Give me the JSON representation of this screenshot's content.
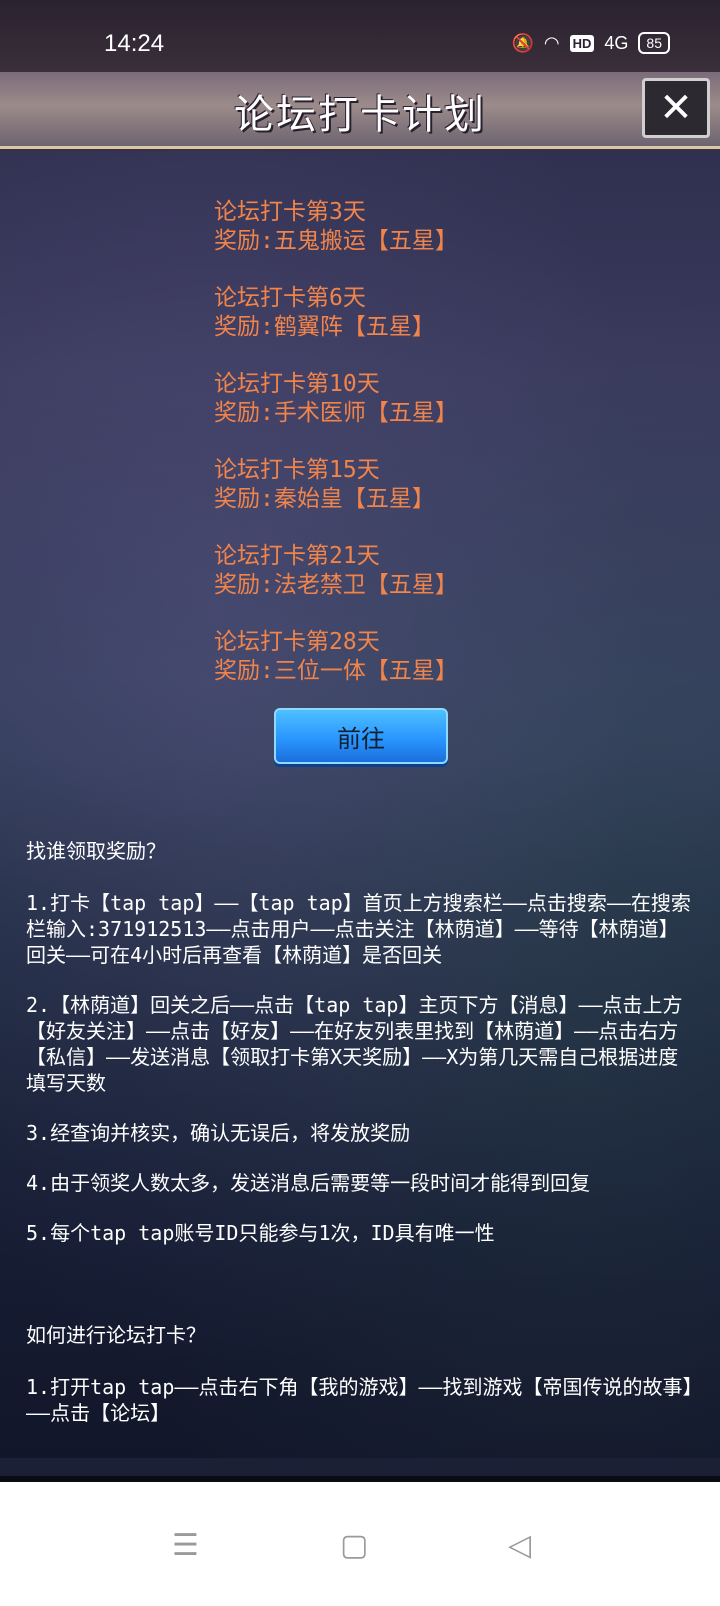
{
  "status": {
    "time": "14:24",
    "network": "4G",
    "hd": "HD",
    "battery": "85"
  },
  "header": {
    "title": "论坛打卡计划"
  },
  "rewards": [
    {
      "day": "论坛打卡第3天",
      "reward": "奖励:五鬼搬运【五星】"
    },
    {
      "day": "论坛打卡第6天",
      "reward": "奖励:鹤翼阵【五星】"
    },
    {
      "day": "论坛打卡第10天",
      "reward": "奖励:手术医师【五星】"
    },
    {
      "day": "论坛打卡第15天",
      "reward": "奖励:秦始皇【五星】"
    },
    {
      "day": "论坛打卡第21天",
      "reward": "奖励:法老禁卫【五星】"
    },
    {
      "day": "论坛打卡第28天",
      "reward": "奖励:三位一体【五星】"
    }
  ],
  "go_button": "前往",
  "guide": {
    "claim_heading": "找谁领取奖励？",
    "claim_steps": [
      "1.打卡【tap tap】——【tap tap】首页上方搜索栏——点击搜索——在搜索栏输入:371912513——点击用户——点击关注【林荫道】——等待【林荫道】回关——可在4小时后再查看【林荫道】是否回关",
      "2.【林荫道】回关之后——点击【tap tap】主页下方【消息】——点击上方【好友关注】——点击【好友】——在好友列表里找到【林荫道】——点击右方【私信】——发送消息【领取打卡第X天奖励】——X为第几天需自己根据进度填写天数",
      "3.经查询并核实，确认无误后，将发放奖励",
      "4.由于领奖人数太多，发送消息后需要等一段时间才能得到回复",
      "5.每个tap tap账号ID只能参与1次，ID具有唯一性"
    ],
    "howto_heading": "如何进行论坛打卡？",
    "howto_steps": [
      "1.打开tap tap——点击右下角【我的游戏】——找到游戏【帝国传说的故事】——点击【论坛】"
    ]
  },
  "nav": {
    "menu_icon": "☰",
    "home_icon": "▢",
    "back_icon": "◁"
  }
}
